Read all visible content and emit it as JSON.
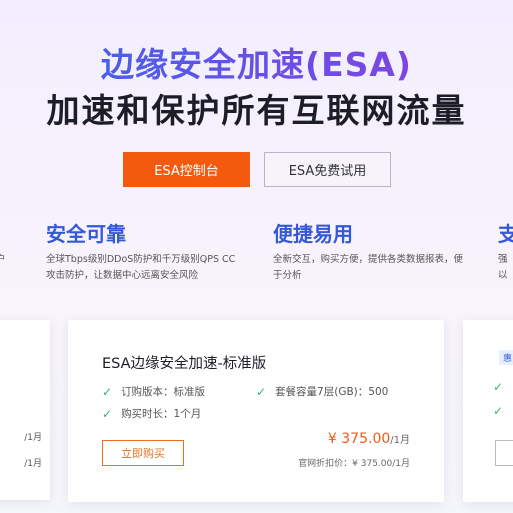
{
  "hero": {
    "title": "边缘安全加速(ESA)",
    "subtitle": "加速和保护所有互联网流量",
    "primary_button": "ESA控制台",
    "secondary_button": "ESA免费试用"
  },
  "features": [
    {
      "title": "",
      "desc_line1": "户",
      "desc_line2": ""
    },
    {
      "title": "安全可靠",
      "desc_line1": "全球Tbps级别DDoS防护和千万级别QPS CC",
      "desc_line2": "攻击防护，让数据中心远离安全风险"
    },
    {
      "title": "便捷易用",
      "desc_line1": "全新交互，购买方便，提供各类数据报表，便",
      "desc_line2": "于分析"
    },
    {
      "title": "支",
      "desc_line1": "强",
      "desc_line2": "以"
    }
  ],
  "left_card": {
    "price1": "/1月",
    "price2": "/1月"
  },
  "main_card": {
    "title": "ESA边缘安全加速-标准版",
    "specs": [
      "订购版本：标准版",
      "套餐容量7层(GB)：500",
      "购买时长：1个月"
    ],
    "buy_button": "立即购买",
    "price_amount": "¥ 375.00",
    "price_unit": "/1月",
    "original_price": "官网折扣价：¥ 375.00/1月"
  },
  "right_card": {
    "tag": "惠"
  },
  "colors": {
    "accent_orange": "#f35a0e",
    "title_blue": "#3358d8",
    "check_green": "#3bb36b"
  }
}
